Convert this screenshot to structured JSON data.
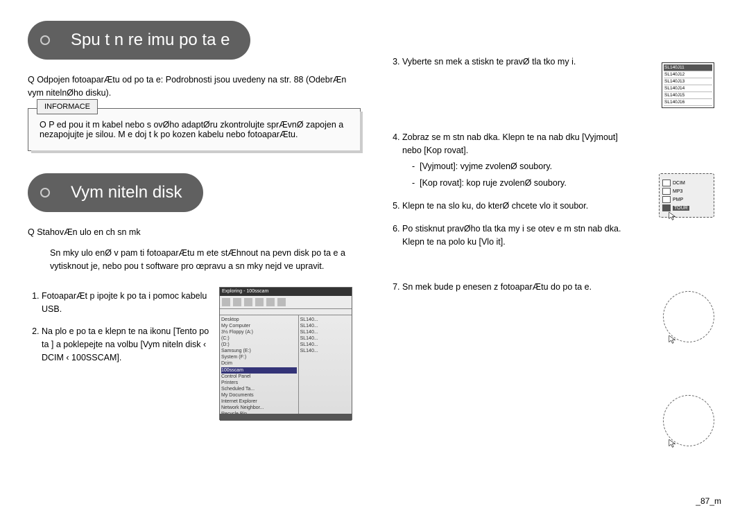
{
  "header1": "Spu t n  re imu po ta e",
  "header2": "Vym niteln  disk",
  "p1_prefix": "Q",
  "p1": " Odpojen  fotoaparÆtu od po ta e: Podrobnosti jsou uvedeny na str. 88 (OdebrÆn  vym nitelnØho disku).",
  "info_tab": "INFORMACE",
  "info_prefix": "O",
  "info_body": " P ed pou it m kabel  nebo s  ovØho adaptØru zkontrolujte sprÆvnØ zapojen  a nezapojujte je silou. M e doj t k po kozen  kabelu nebo fotoaparÆtu.",
  "p2_prefix": "Q",
  "p2": " StahovÆn  ulo en ch sn mk",
  "p2_body": "Sn mky ulo enØ v pam ti fotoaparÆtu m ete stÆhnout na pevn  disk po ta e a vytisknout je, nebo pou t software pro œpravu a sn mky nejd ve upravit.",
  "steps_left": [
    "FotoaparÆt p ipojte k po ta i pomoc  kabelu USB.",
    "Na plo e po ta e klepn te na ikonu [Tento po ta ] a poklepejte na volbu [Vym niteln  disk  ‹  DCIM  ‹  100SSCAM]."
  ],
  "steps_right": [
    {
      "n": 3,
      "text": "Vyberte sn mek a stiskn te pravØ tla tko my i."
    },
    {
      "n": 4,
      "text": "Zobraz  se m stn  nab dka. Klepn te na nab dku [Vyjmout] nebo [Kop rovat].",
      "sub": [
        "[Vyjmout]: vyjme zvolenØ soubory.",
        "[Kop rovat]: kop ruje zvolenØ soubory."
      ]
    },
    {
      "n": 5,
      "text": "Klepn te na slo ku, do kterØ chcete vlo it soubor."
    },
    {
      "n": 6,
      "text": "Po stisknut  pravØho tla tka my i se otev e m stn  nab dka. Klepn te na polo ku [Vlo it]."
    },
    {
      "n": 7,
      "text": "Sn mek bude p enesen z fotoaparÆtu do po ta e."
    }
  ],
  "screenshot": {
    "title": "Exploring - 100sscam",
    "tree": [
      "Desktop",
      " My Computer",
      "  3½ Floppy (A:)",
      "  (C:)",
      "  (D:)",
      "   Samsung (E:)",
      "  System (F:)",
      "   Dcim",
      "    100sscam",
      "  Control Panel",
      "  Printers",
      "  Scheduled Ta...",
      "  My Documents",
      "  Internet Explorer",
      "  Network Neighbor...",
      "  Recycle Bin"
    ],
    "list": [
      "SL140...",
      "SL140...",
      "SL140...",
      "SL140...",
      "SL140...",
      "SL140..."
    ]
  },
  "filelist": {
    "items": [
      "SL140J11",
      "SL140J12",
      "SL140J13",
      "SL140J14",
      "SL140J15",
      "SL140J16"
    ]
  },
  "contextmenu": {
    "items": [
      "DCIM",
      "MP3",
      "PMP",
      "TOUR"
    ]
  },
  "page_num": "_87_m"
}
